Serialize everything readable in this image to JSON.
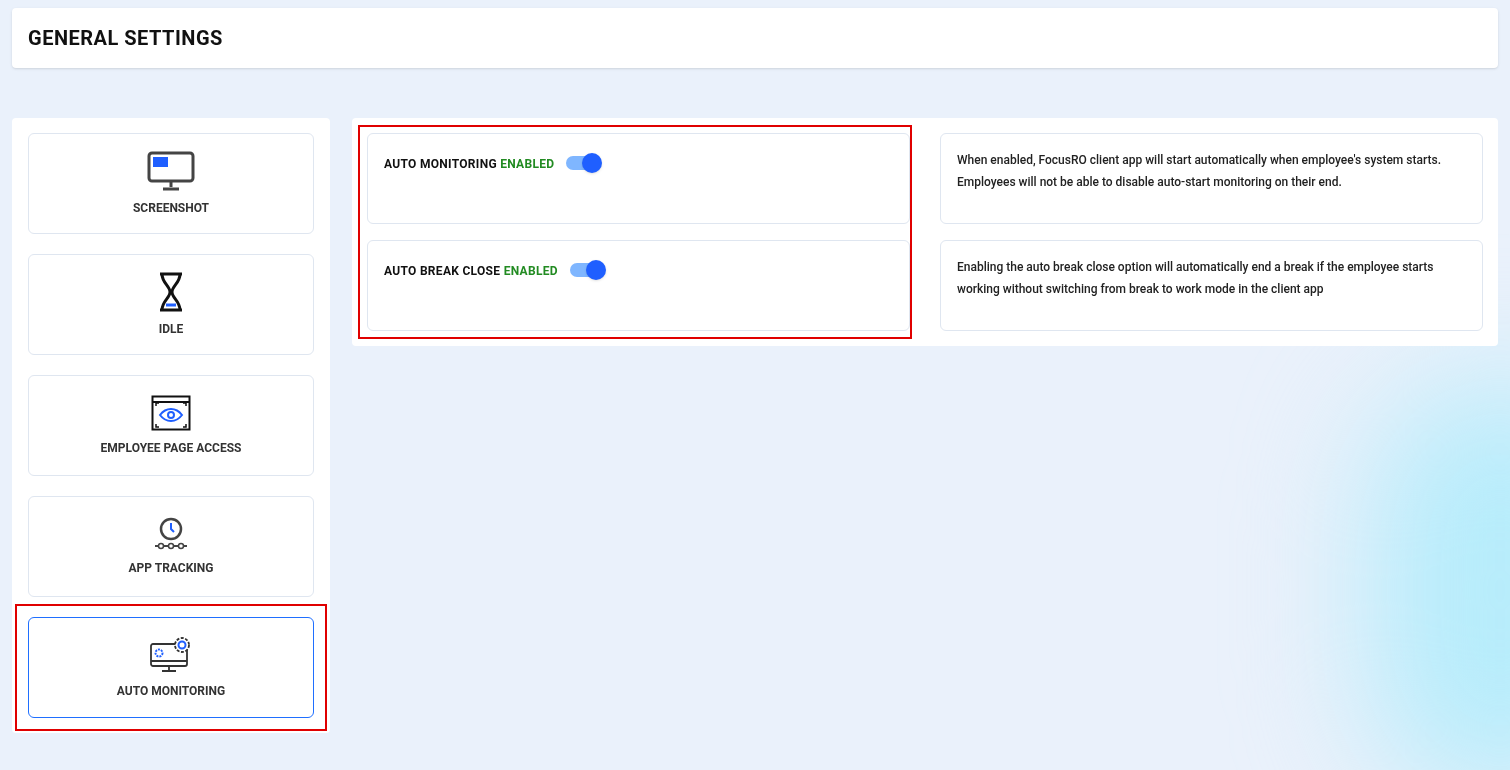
{
  "header": {
    "title": "GENERAL SETTINGS"
  },
  "sidebar": {
    "items": [
      {
        "label": "SCREENSHOT",
        "kind": "screenshot",
        "selected": false
      },
      {
        "label": "IDLE",
        "kind": "idle",
        "selected": false
      },
      {
        "label": "EMPLOYEE PAGE ACCESS",
        "kind": "page-access",
        "selected": false
      },
      {
        "label": "APP TRACKING",
        "kind": "app-tracking",
        "selected": false
      },
      {
        "label": "AUTO MONITORING",
        "kind": "auto-monitoring",
        "selected": true
      }
    ]
  },
  "settings": [
    {
      "label": "AUTO MONITORING",
      "status": "ENABLED",
      "on": true,
      "description": "When enabled, FocusRO client app will start automatically when employee's system starts. Employees will not be able to disable auto-start monitoring on their end."
    },
    {
      "label": "AUTO BREAK CLOSE",
      "status": "ENABLED",
      "on": true,
      "description": "Enabling the auto break close option will automatically end a break if the employee starts working without switching from break to work mode in the client app"
    }
  ]
}
